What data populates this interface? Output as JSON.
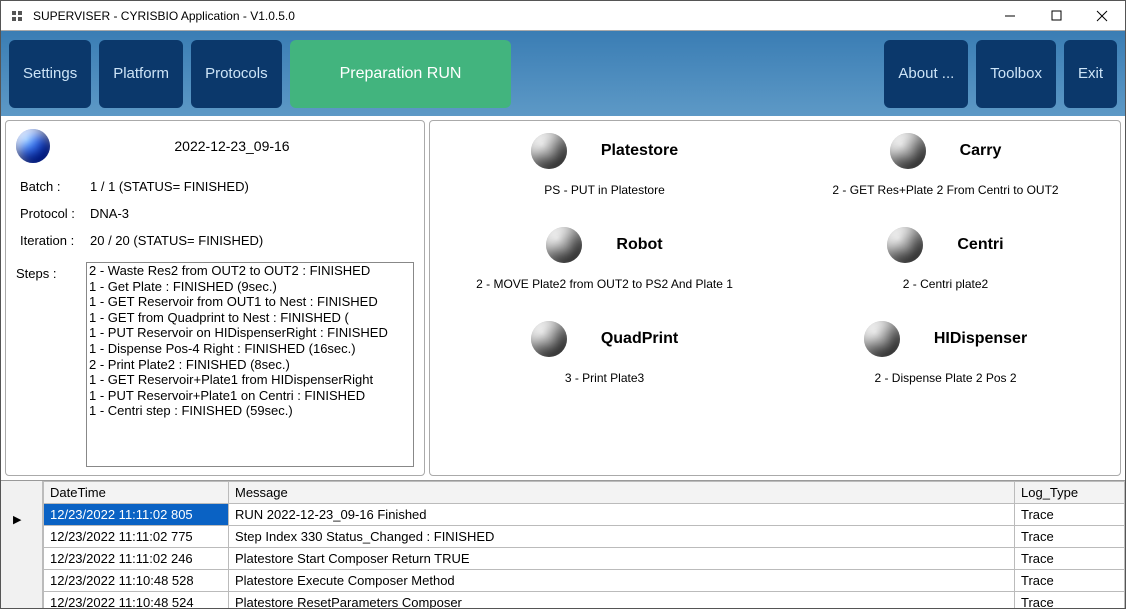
{
  "window": {
    "title": "SUPERVISER   -   CYRISBIO Application - V1.0.5.0"
  },
  "menubar": {
    "settings": "Settings",
    "platform": "Platform",
    "protocols": "Protocols",
    "run": "Preparation RUN",
    "about": "About ...",
    "toolbox": "Toolbox",
    "exit": "Exit"
  },
  "run": {
    "timestamp": "2022-12-23_09-16",
    "batch_label": "Batch :",
    "batch_value": "1 / 1 (STATUS= FINISHED)",
    "protocol_label": "Protocol :",
    "protocol_value": "DNA-3",
    "iteration_label": "Iteration :",
    "iteration_value": "20 / 20 (STATUS= FINISHED)",
    "steps_label": "Steps :",
    "steps": [
      "2 - Waste Res2 from OUT2 to OUT2 : FINISHED",
      "1 - Get Plate : FINISHED (9sec.)",
      "1 - GET Reservoir from OUT1 to Nest : FINISHED",
      "1 - GET from Quadprint to Nest : FINISHED (",
      "1 - PUT Reservoir on HIDispenserRight : FINISHED",
      "1 - Dispense Pos-4 Right : FINISHED (16sec.)",
      "2 - Print Plate2 : FINISHED (8sec.)",
      "1 - GET Reservoir+Plate1 from HIDispenserRight",
      "1 - PUT Reservoir+Plate1 on Centri : FINISHED",
      "1 - Centri step : FINISHED (59sec.)"
    ]
  },
  "devices": [
    {
      "name": "Platestore",
      "status": "PS - PUT in Platestore"
    },
    {
      "name": "Carry",
      "status": "2 - GET Res+Plate 2 From Centri to OUT2"
    },
    {
      "name": "Robot",
      "status": "2 - MOVE Plate2 from OUT2 to PS2 And Plate 1"
    },
    {
      "name": "Centri",
      "status": "2 - Centri plate2"
    },
    {
      "name": "QuadPrint",
      "status": "3 - Print Plate3"
    },
    {
      "name": "HIDispenser",
      "status": "2 - Dispense Plate 2 Pos 2"
    }
  ],
  "log": {
    "headers": {
      "dt": "DateTime",
      "msg": "Message",
      "type": "Log_Type"
    },
    "rows": [
      {
        "dt": "12/23/2022 11:11:02 805",
        "msg": "RUN 2022-12-23_09-16 Finished",
        "type": "Trace",
        "selected": true
      },
      {
        "dt": "12/23/2022 11:11:02 775",
        "msg": "Step Index 330 Status_Changed : FINISHED",
        "type": "Trace"
      },
      {
        "dt": "12/23/2022 11:11:02 246",
        "msg": "Platestore Start Composer Return TRUE",
        "type": "Trace"
      },
      {
        "dt": "12/23/2022 11:10:48 528",
        "msg": "Platestore Execute Composer Method",
        "type": "Trace"
      },
      {
        "dt": "12/23/2022 11:10:48 524",
        "msg": "Platestore ResetParameters Composer",
        "type": "Trace"
      }
    ]
  }
}
